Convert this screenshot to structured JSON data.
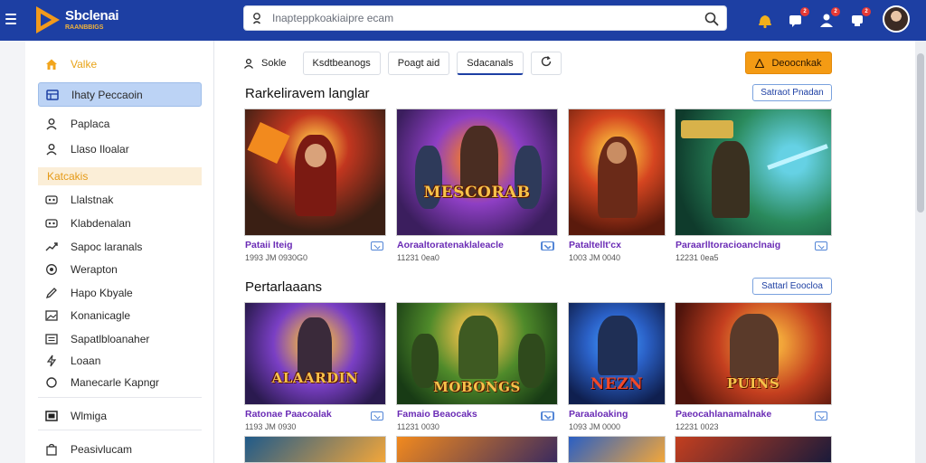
{
  "header": {
    "logo_title": "Sbclenai",
    "logo_subtitle": "RAANBBIGS",
    "search_placeholder": "Inapteppkoakiaipre ecam",
    "notification_badges": [
      "2",
      "2",
      "2"
    ],
    "icons": [
      "menu-icon",
      "search-icon",
      "bell-icon",
      "chat-icon",
      "user-icon",
      "trophy-icon"
    ]
  },
  "sidebar": {
    "items": [
      {
        "label": "Valke",
        "icon": "home-icon",
        "state": "home"
      },
      {
        "label": "Ihaty Peccaoin",
        "icon": "grid-icon",
        "state": "active"
      },
      {
        "label": "Paplaca",
        "icon": "person-icon"
      },
      {
        "label": "Llaso Iloalar",
        "icon": "person-icon"
      }
    ],
    "section_label": "Katcakis",
    "section_items": [
      {
        "label": "Llalstnak",
        "icon": "gamepad-icon"
      },
      {
        "label": "Klabdenalan",
        "icon": "gamepad-icon"
      },
      {
        "label": "Sapoc laranals",
        "icon": "trend-icon"
      },
      {
        "label": "Werapton",
        "icon": "target-icon"
      },
      {
        "label": "Hapo Kbyale",
        "icon": "pen-icon"
      },
      {
        "label": "Konanicagle",
        "icon": "image-icon"
      },
      {
        "label": "Sapatlbloanaher",
        "icon": "list-icon"
      },
      {
        "label": "Loaan",
        "icon": "bolt-icon"
      },
      {
        "label": "Manecarle Kapngr",
        "icon": "circle-icon"
      }
    ],
    "footer_items": [
      {
        "label": "Wlmiga",
        "icon": "film-icon"
      },
      {
        "label": "Peasivlucam",
        "icon": "bag-icon"
      }
    ]
  },
  "main": {
    "tabs": [
      {
        "label": "Sokle",
        "icon": "person-icon"
      },
      {
        "label": "Ksdtbeanogs"
      },
      {
        "label": "Poagt aid"
      },
      {
        "label": "Sdacanals",
        "selected": true
      }
    ],
    "cta_label": "Deoocnkak",
    "sections": [
      {
        "title": "Rarkeliravem langlar",
        "action_label": "Satraot Pnadan",
        "cards": [
          {
            "title": "Pataii Iteig",
            "meta": "1993 JM 0930G0",
            "art_text": "",
            "palette": [
              "#3a1f14",
              "#c2361f",
              "#f0a03c"
            ]
          },
          {
            "title": "Aoraaltoratenaklaleacle",
            "meta": "11231  0ea0",
            "art_text": "MESCORAB",
            "palette": [
              "#3b1e5e",
              "#8e3fc4",
              "#f27a2c"
            ]
          },
          {
            "title": "Pataltellt'cx",
            "meta": "1003 JM 0040",
            "art_text": "",
            "palette": [
              "#5a1a0c",
              "#d54520",
              "#f7b43a"
            ]
          },
          {
            "title": "Paraarlltoracioanclnaig",
            "meta": "12231  0ea5",
            "art_text": "",
            "palette": [
              "#0f3b2c",
              "#2a8a5c",
              "#65d1e4"
            ]
          }
        ]
      },
      {
        "title": "Pertarlaaans",
        "action_label": "Sattarl Eoocloa",
        "cards": [
          {
            "title": "Ratonae Paacoalak",
            "meta": "1193 JM 0930",
            "art_text": "ALAARDIN",
            "palette": [
              "#2a1a4f",
              "#7a3fc4",
              "#f2b642"
            ]
          },
          {
            "title": "Famaio Beaocaks",
            "meta": "11231  0030",
            "art_text": "MOBONGS",
            "palette": [
              "#183b15",
              "#4f8a2a",
              "#f2c14a"
            ]
          },
          {
            "title": "Paraaloaking",
            "meta": "1093 JM 0000",
            "art_text": "NEZN",
            "palette": [
              "#0f1f4f",
              "#2a5fc4",
              "#f24a2a"
            ]
          },
          {
            "title": "Paeocahlanamalnake",
            "meta": "12231  0023",
            "art_text": "PUINS",
            "palette": [
              "#4f140c",
              "#c43f1f",
              "#f2a63a"
            ]
          }
        ]
      }
    ]
  }
}
